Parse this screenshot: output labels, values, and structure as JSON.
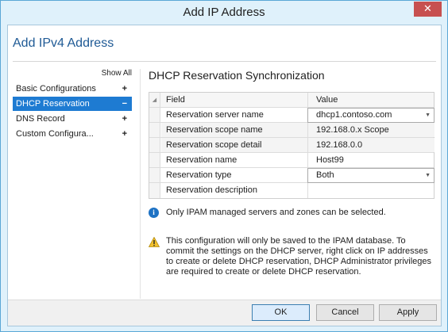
{
  "window": {
    "title": "Add IP Address",
    "close_label": "✕"
  },
  "page": {
    "heading": "Add IPv4 Address"
  },
  "nav": {
    "show_all": "Show All",
    "items": [
      {
        "label": "Basic Configurations",
        "sign": "+"
      },
      {
        "label": "DHCP Reservation",
        "sign": "−",
        "selected": true
      },
      {
        "label": "DNS Record",
        "sign": "+"
      },
      {
        "label": "Custom Configura...",
        "sign": "+"
      }
    ]
  },
  "section": {
    "title": "DHCP Reservation Synchronization"
  },
  "grid": {
    "columns": [
      "Field",
      "Value"
    ],
    "rows": [
      {
        "field": "Reservation server name",
        "value": "dhcp1.contoso.com",
        "dropdown": true
      },
      {
        "field": "Reservation scope name",
        "value": "192.168.0.x Scope"
      },
      {
        "field": "Reservation scope detail",
        "value": "192.168.0.0"
      },
      {
        "field": "Reservation name",
        "value": "Host99"
      },
      {
        "field": "Reservation type",
        "value": "Both",
        "dropdown": true
      },
      {
        "field": "Reservation description",
        "value": ""
      }
    ]
  },
  "info": {
    "icon": "info-icon",
    "text": "Only IPAM managed servers and zones can be selected."
  },
  "warning": {
    "icon": "warning-icon",
    "text": "This configuration will only be saved to the IPAM database. To commit the settings on the DHCP server, right click on IP addresses to create or delete DHCP reservation, DHCP Administrator privileges are required to create or delete DHCP reservation."
  },
  "buttons": {
    "ok": "OK",
    "cancel": "Cancel",
    "apply": "Apply"
  },
  "colors": {
    "accent": "#1e7bd2",
    "heading": "#1f5a95",
    "close": "#c75050"
  }
}
